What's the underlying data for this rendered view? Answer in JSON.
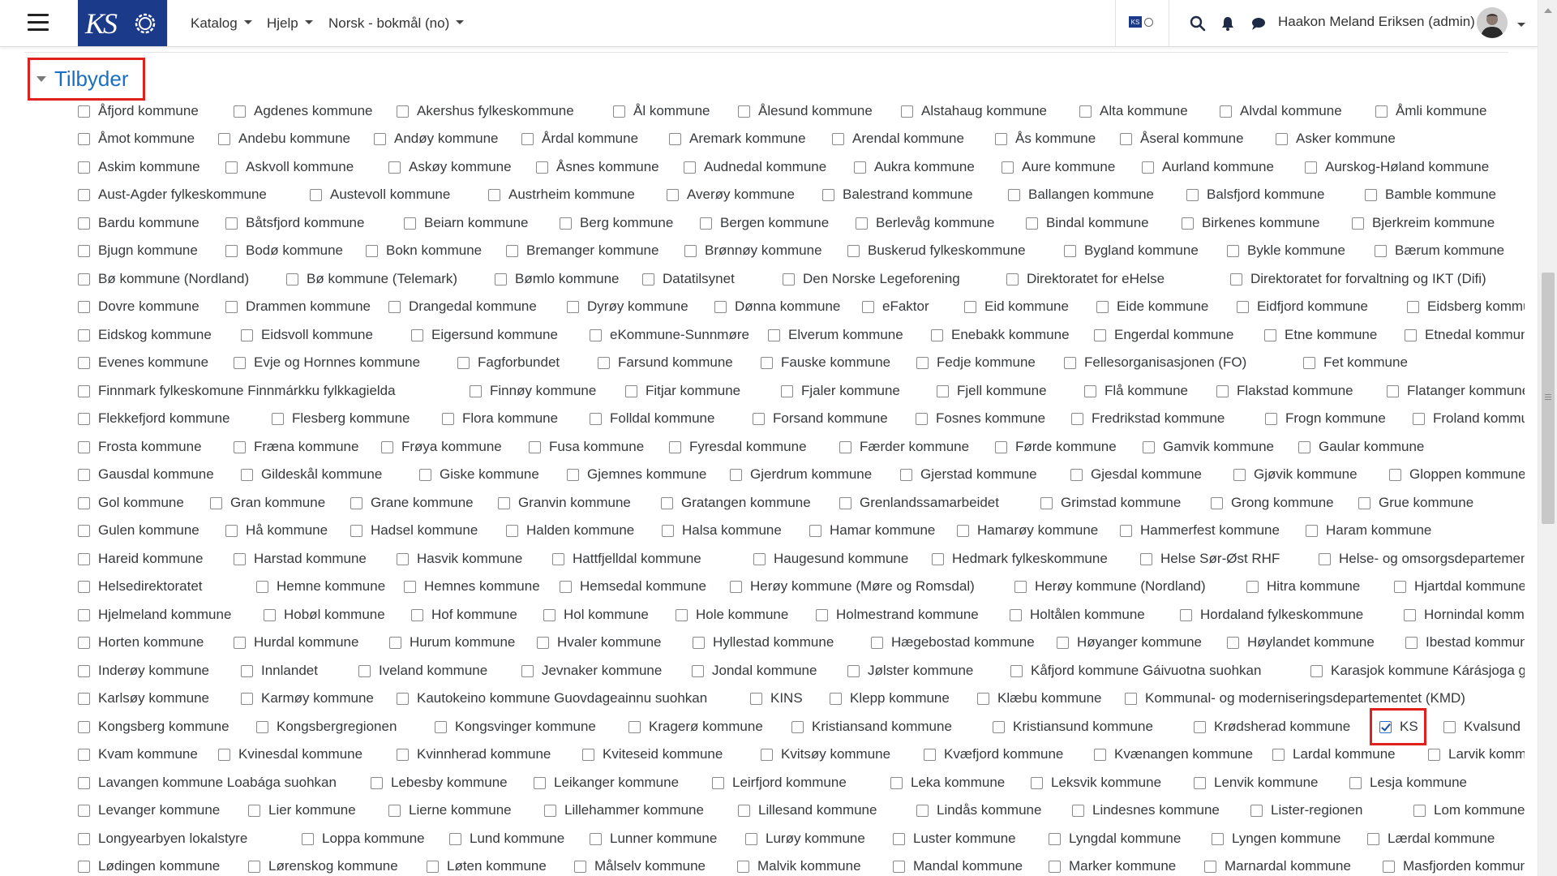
{
  "navbar": {
    "menus": [
      {
        "label": "Katalog"
      },
      {
        "label": "Hjelp"
      },
      {
        "label": "Norsk - bokmål (no)"
      }
    ],
    "user_name": "Haakon Meland Eriksen (admin)",
    "logo_text": "KS",
    "edit_toggle_text": "KS"
  },
  "accent_color": "#1a6fc0",
  "highlight_color": "#e0201c",
  "section": {
    "title": "Tilbyder"
  },
  "provider_rows": [
    [
      "Åfjord kommune",
      "Agdenes kommune",
      "Akershus fylkeskommune",
      "Ål kommune",
      "Ålesund kommune",
      "Alstahaug kommune",
      "Alta kommune",
      "Alvdal kommune",
      "Åmli kommune"
    ],
    [
      "Åmot kommune",
      "Andebu kommune",
      "Andøy kommune",
      "Årdal kommune",
      "Aremark kommune",
      "Arendal kommune",
      "Ås kommune",
      "Åseral kommune",
      "Asker kommune"
    ],
    [
      "Askim kommune",
      "Askvoll kommune",
      "Askøy kommune",
      "Åsnes kommune",
      "Audnedal kommune",
      "Aukra kommune",
      "Aure kommune",
      "Aurland kommune",
      "Aurskog-Høland kommune"
    ],
    [
      "Aust-Agder fylkeskommune",
      "Austevoll kommune",
      "Austrheim kommune",
      "Averøy kommune",
      "Balestrand kommune",
      "Ballangen kommune",
      "Balsfjord kommune",
      "Bamble kommune"
    ],
    [
      "Bardu kommune",
      "Båtsfjord kommune",
      "Beiarn kommune",
      "Berg kommune",
      "Bergen kommune",
      "Berlevåg kommune",
      "Bindal kommune",
      "Birkenes kommune",
      "Bjerkreim kommune"
    ],
    [
      "Bjugn kommune",
      "Bodø kommune",
      "Bokn kommune",
      "Bremanger kommune",
      "Brønnøy kommune",
      "Buskerud fylkeskommune",
      "Bygland kommune",
      "Bykle kommune",
      "Bærum kommune"
    ],
    [
      "Bø kommune (Nordland)",
      "Bø kommune (Telemark)",
      "Bømlo kommune",
      "Datatilsynet",
      "Den Norske Legeforening",
      "Direktoratet for eHelse",
      "Direktoratet for forvaltning og IKT (Difi)"
    ],
    [
      "Dovre kommune",
      "Drammen kommune",
      "Drangedal kommune",
      "Dyrøy kommune",
      "Dønna kommune",
      "eFaktor",
      "Eid kommune",
      "Eide kommune",
      "Eidfjord kommune",
      "Eidsberg kommune"
    ],
    [
      "Eidskog kommune",
      "Eidsvoll kommune",
      "Eigersund kommune",
      "eKommune-Sunnmøre",
      "Elverum kommune",
      "Enebakk kommune",
      "Engerdal kommune",
      "Etne kommune",
      "Etnedal kommune"
    ],
    [
      "Evenes kommune",
      "Evje og Hornnes kommune",
      "Fagforbundet",
      "Farsund kommune",
      "Fauske kommune",
      "Fedje kommune",
      "Fellesorganisasjonen (FO)",
      "Fet kommune"
    ],
    [
      "Finnmark fylkeskomune Finnmárkku fylkkagielda",
      "Finnøy kommune",
      "Fitjar kommune",
      "Fjaler kommune",
      "Fjell kommune",
      "Flå kommune",
      "Flakstad kommune",
      "Flatanger kommune"
    ],
    [
      "Flekkefjord kommune",
      "Flesberg kommune",
      "Flora kommune",
      "Folldal kommune",
      "Forsand kommune",
      "Fosnes kommune",
      "Fredrikstad kommune",
      "Frogn kommune",
      "Froland kommune"
    ],
    [
      "Frosta kommune",
      "Fræna kommune",
      "Frøya kommune",
      "Fusa kommune",
      "Fyresdal kommune",
      "Færder kommune",
      "Førde kommune",
      "Gamvik kommune",
      "Gaular kommune"
    ],
    [
      "Gausdal kommune",
      "Gildeskål kommune",
      "Giske kommune",
      "Gjemnes kommune",
      "Gjerdrum kommune",
      "Gjerstad kommune",
      "Gjesdal kommune",
      "Gjøvik kommune",
      "Gloppen kommune"
    ],
    [
      "Gol kommune",
      "Gran kommune",
      "Grane kommune",
      "Granvin kommune",
      "Gratangen kommune",
      "Grenlandssamarbeidet",
      "Grimstad kommune",
      "Grong kommune",
      "Grue kommune"
    ],
    [
      "Gulen kommune",
      "Hå kommune",
      "Hadsel kommune",
      "Halden kommune",
      "Halsa kommune",
      "Hamar kommune",
      "Hamarøy kommune",
      "Hammerfest kommune",
      "Haram kommune"
    ],
    [
      "Hareid kommune",
      "Harstad kommune",
      "Hasvik kommune",
      "Hattfjelldal kommune",
      "Haugesund kommune",
      "Hedmark fylkeskommune",
      "Helse Sør-Øst RHF",
      "Helse- og omsorgsdepartementet (HOD)"
    ],
    [
      "Helsedirektoratet",
      "Hemne kommune",
      "Hemnes kommune",
      "Hemsedal kommune",
      "Herøy kommune (Møre og Romsdal)",
      "Herøy kommune (Nordland)",
      "Hitra kommune",
      "Hjartdal kommune"
    ],
    [
      "Hjelmeland kommune",
      "Hobøl kommune",
      "Hof kommune",
      "Hol kommune",
      "Hole kommune",
      "Holmestrand kommune",
      "Holtålen kommune",
      "Hordaland fylkeskommune",
      "Hornindal kommune"
    ],
    [
      "Horten kommune",
      "Hurdal kommune",
      "Hurum kommune",
      "Hvaler kommune",
      "Hyllestad kommune",
      "Hægebostad kommune",
      "Høyanger kommune",
      "Høylandet kommune",
      "Ibestad kommune"
    ],
    [
      "Inderøy kommune",
      "Innlandet",
      "Iveland kommune",
      "Jevnaker kommune",
      "Jondal kommune",
      "Jølster kommune",
      "Kåfjord kommune Gáivuotna suohkan",
      "Karasjok kommune Kárásjoga gielda"
    ],
    [
      "Karlsøy kommune",
      "Karmøy kommune",
      "Kautokeino kommune Guovdageainnu suohkan",
      "KINS",
      "Klepp kommune",
      "Klæbu kommune",
      "Kommunal- og moderniseringsdepartementet (KMD)"
    ],
    [
      "Kongsberg kommune",
      "Kongsbergregionen",
      "Kongsvinger kommune",
      "Kragerø kommune",
      "Kristiansand kommune",
      "Kristiansund kommune",
      "Krødsherad kommune",
      "KS",
      "Kvalsund kommune"
    ],
    [
      "Kvam kommune",
      "Kvinesdal kommune",
      "Kvinnherad kommune",
      "Kviteseid kommune",
      "Kvitsøy kommune",
      "Kvæfjord kommune",
      "Kvænangen kommune",
      "Lardal kommune",
      "Larvik kommune"
    ],
    [
      "Lavangen kommune Loabága suohkan",
      "Lebesby kommune",
      "Leikanger kommune",
      "Leirfjord kommune",
      "Leka kommune",
      "Leksvik kommune",
      "Lenvik kommune",
      "Lesja kommune"
    ],
    [
      "Levanger kommune",
      "Lier kommune",
      "Lierne kommune",
      "Lillehammer kommune",
      "Lillesand kommune",
      "Lindås kommune",
      "Lindesnes kommune",
      "Lister-regionen",
      "Lom kommune"
    ],
    [
      "Longyearbyen lokalstyre",
      "Loppa kommune",
      "Lund kommune",
      "Lunner kommune",
      "Lurøy kommune",
      "Luster kommune",
      "Lyngdal kommune",
      "Lyngen kommune",
      "Lærdal kommune"
    ],
    [
      "Lødingen kommune",
      "Lørenskog kommune",
      "Løten kommune",
      "Målselv kommune",
      "Malvik kommune",
      "Mandal kommune",
      "Marker kommune",
      "Marnardal kommune",
      "Masfjorden kommune"
    ]
  ],
  "checked": [
    "KS"
  ]
}
